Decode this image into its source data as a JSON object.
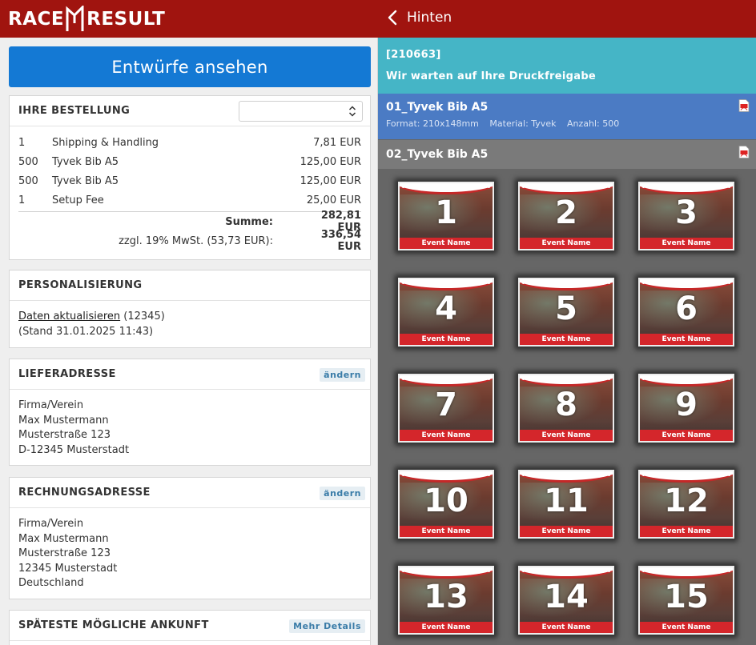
{
  "brand": {
    "word1": "RACE",
    "word2": "RESULT"
  },
  "nav": {
    "back_label": "Hinten"
  },
  "left": {
    "primary_button": "Entwürfe ansehen",
    "order": {
      "title": "IHRE BESTELLUNG",
      "select_value": "",
      "rows": [
        {
          "qty": "1",
          "name": "Shipping & Handling",
          "price": "7,81 EUR"
        },
        {
          "qty": "500",
          "name": "Tyvek Bib A5",
          "price": "125,00 EUR"
        },
        {
          "qty": "500",
          "name": "Tyvek Bib A5",
          "price": "125,00 EUR"
        },
        {
          "qty": "1",
          "name": "Setup Fee",
          "price": "25,00 EUR"
        }
      ],
      "sum_label": "Summe:",
      "sum_value": "282,81 EUR",
      "tax_label": "zzgl. 19% MwSt. (53,73 EUR):",
      "tax_value": "336,54 EUR"
    },
    "personalization": {
      "title": "PERSONALISIERUNG",
      "link": "Daten aktualisieren",
      "count": "(12345)",
      "stand": "(Stand 31.01.2025 11:43)"
    },
    "delivery": {
      "title": "LIEFERADRESSE",
      "edit": "ändern",
      "lines": [
        "Firma/Verein",
        "Max Mustermann",
        "Musterstraße 123",
        "D-12345 Musterstadt"
      ]
    },
    "billing": {
      "title": "RECHNUNGSADRESSE",
      "edit": "ändern",
      "lines": [
        "Firma/Verein",
        "Max Mustermann",
        "Musterstraße 123",
        "12345 Musterstadt",
        "Deutschland"
      ]
    },
    "arrival": {
      "title": "SPÄTESTE MÖGLICHE ANKUNFT",
      "more": "Mehr Details"
    }
  },
  "right": {
    "order_id": "[210663]",
    "status": "Wir warten auf Ihre Druckfreigabe",
    "job1": {
      "title": "01_Tyvek Bib A5",
      "format": "Format: 210x148mm",
      "material": "Material: Tyvek",
      "amount": "Anzahl: 500"
    },
    "job2": {
      "title": "02_Tyvek Bib A5"
    },
    "bibs": [
      {
        "number": "1",
        "label": "Event Name"
      },
      {
        "number": "2",
        "label": "Event Name"
      },
      {
        "number": "3",
        "label": "Event Name"
      },
      {
        "number": "4",
        "label": "Event Name"
      },
      {
        "number": "5",
        "label": "Event Name"
      },
      {
        "number": "6",
        "label": "Event Name"
      },
      {
        "number": "7",
        "label": "Event Name"
      },
      {
        "number": "8",
        "label": "Event Name"
      },
      {
        "number": "9",
        "label": "Event Name"
      },
      {
        "number": "10",
        "label": "Event Name"
      },
      {
        "number": "11",
        "label": "Event Name"
      },
      {
        "number": "12",
        "label": "Event Name"
      },
      {
        "number": "13",
        "label": "Event Name"
      },
      {
        "number": "14",
        "label": "Event Name"
      },
      {
        "number": "15",
        "label": "Event Name"
      }
    ]
  },
  "colors": {
    "topbar": "#a0140f",
    "primary": "#1479d4",
    "status": "#45b5c6",
    "job_active": "#4b7bc4"
  },
  "icons": {
    "back": "chevron-left-icon",
    "pdf": "pdf-icon",
    "select": "updown-arrows-icon"
  }
}
